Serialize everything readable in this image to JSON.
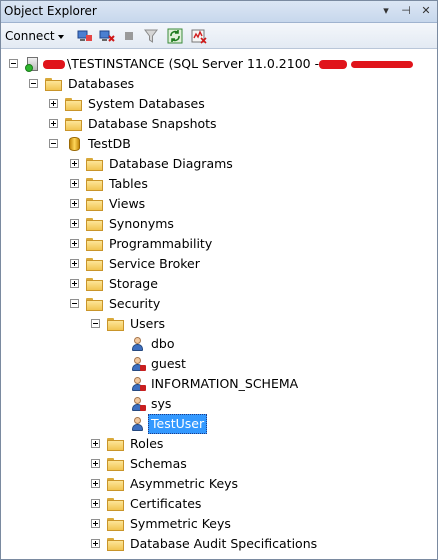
{
  "window": {
    "title": "Object Explorer"
  },
  "toolbar": {
    "connect_label": "Connect"
  },
  "server": {
    "label": "\\TESTINSTANCE (SQL Server 11.0.2100 - "
  },
  "tree": {
    "databases": "Databases",
    "system_databases": "System Databases",
    "database_snapshots": "Database Snapshots",
    "testdb": "TestDB",
    "database_diagrams": "Database Diagrams",
    "tables": "Tables",
    "views": "Views",
    "synonyms": "Synonyms",
    "programmability": "Programmability",
    "service_broker": "Service Broker",
    "storage": "Storage",
    "security": "Security",
    "users": "Users",
    "user_dbo": "dbo",
    "user_guest": "guest",
    "user_information_schema": "INFORMATION_SCHEMA",
    "user_sys": "sys",
    "user_testuser": "TestUser",
    "roles": "Roles",
    "schemas": "Schemas",
    "asymmetric_keys": "Asymmetric Keys",
    "certificates": "Certificates",
    "symmetric_keys": "Symmetric Keys",
    "database_audit_specifications": "Database Audit Specifications"
  },
  "colors": {
    "selection": "#3399ff",
    "folder": "#f1c552",
    "database": "#ffd75a"
  }
}
